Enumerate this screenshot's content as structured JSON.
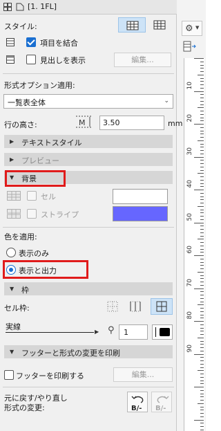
{
  "titlebar": {
    "label": "[1. 1FL]"
  },
  "style_row": {
    "label": "スタイル:"
  },
  "merge_items": {
    "label": "項目を結合",
    "checked": true
  },
  "show_headers": {
    "label": "見出しを表示",
    "checked": false,
    "edit_button": "編集..."
  },
  "format_options": {
    "label": "形式オプション適用:",
    "selected": "一覧表全体"
  },
  "row_height": {
    "label": "行の高さ:",
    "value": "3.50",
    "unit": "mm"
  },
  "sections": {
    "text_style": "テキストスタイル",
    "preview": "プレビュー",
    "background": "背景",
    "frame": "枠",
    "footer": "フッターと形式の変更を印刷"
  },
  "background": {
    "cell_label": "セル",
    "stripe_label": "ストライプ",
    "cell_color": "#ffffff",
    "stripe_color": "#6666ff"
  },
  "apply_color": {
    "label": "色を適用:",
    "option_display": "表示のみ",
    "option_display_output": "表示と出力",
    "selected": "表示と出力"
  },
  "frame": {
    "cell_frame_label": "セル枠:",
    "line_type": "実線",
    "pen_number": "1"
  },
  "footer": {
    "print_label": "フッターを印刷する",
    "edit_button": "編集..."
  },
  "undo": {
    "line1": "元に戻す/やり直し",
    "line2": "形式の変更:"
  },
  "ruler": {
    "labels": [
      "10",
      "20",
      "30",
      "40",
      "50",
      "60",
      "70",
      "80",
      "90"
    ]
  },
  "colors": {
    "accent": "#1a6fd1",
    "highlight": "#e01b1b",
    "stripe": "#6666ff"
  }
}
